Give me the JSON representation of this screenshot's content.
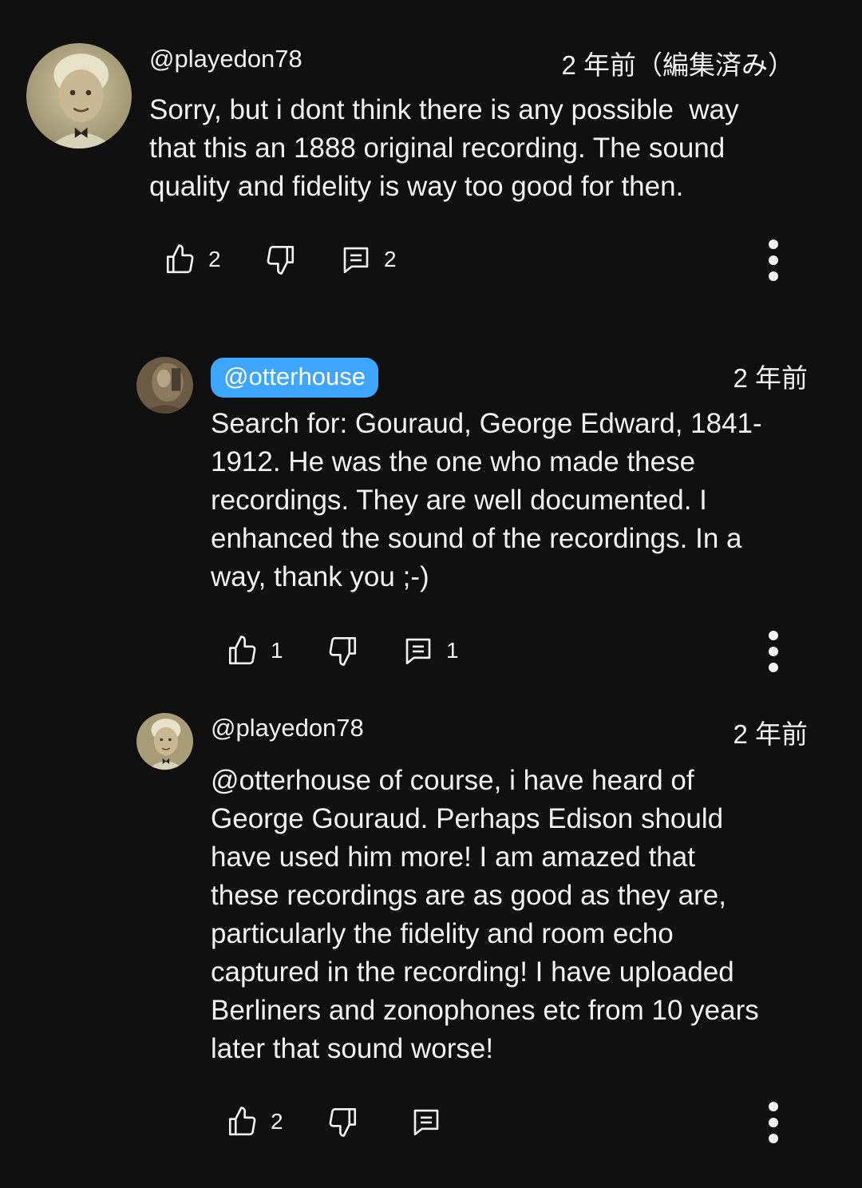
{
  "comments": [
    {
      "author": "@playedon78",
      "time": "2 年前（編集済み）",
      "text": "Sorry, but i dont think there is any possible  way\nthat this an 1888 original recording. The sound\nquality and fidelity is way too good for then.",
      "likes": "2",
      "replies": "2",
      "avatar_icon": "child-portrait"
    },
    {
      "author": "@otterhouse",
      "time": "2 年前",
      "text": "Search for: Gouraud, George Edward, 1841-\n1912. He was the one who made these\nrecordings. They are well documented. I\nenhanced the sound of the recordings. In a\nway, thank you ;-)",
      "likes": "1",
      "replies": "1",
      "avatar_icon": "sepia-portrait"
    },
    {
      "author": "@playedon78",
      "time": "2 年前",
      "text": "@otterhouse of course, i have heard of\nGeorge Gouraud. Perhaps Edison should\nhave used him more! I am amazed that\nthese recordings are as good as they are,\nparticularly the fidelity and room echo\ncaptured in the recording! I have uploaded\nBerliners and zonophones etc from 10 years\nlater that sound worse!",
      "likes": "2",
      "replies": "",
      "avatar_icon": "child-portrait"
    }
  ],
  "icons": {
    "like": "thumbs-up-icon",
    "dislike": "thumbs-down-icon",
    "reply": "reply-comment-icon",
    "more": "more-vertical-icon"
  },
  "colors": {
    "background": "#0f0f0f",
    "text": "#f1f1f1",
    "highlight": "#3ea6ff"
  }
}
